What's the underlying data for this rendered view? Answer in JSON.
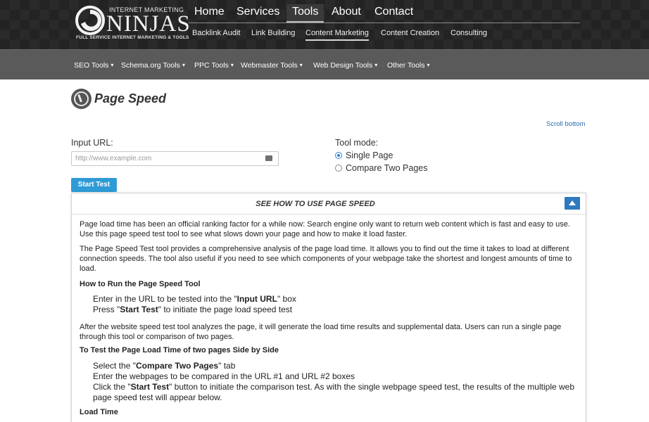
{
  "brand": {
    "top_text": "INTERNET MARKETING",
    "main_text": "NINJAS",
    "sub_text": "FULL SERVICE INTERNET MARKETING & TOOLS"
  },
  "main_nav": {
    "items": [
      {
        "label": "Home"
      },
      {
        "label": "Services"
      },
      {
        "label": "Tools"
      },
      {
        "label": "About"
      },
      {
        "label": "Contact"
      }
    ],
    "active": "Tools"
  },
  "sub_nav": {
    "items": [
      {
        "label": "Backlink Audit"
      },
      {
        "label": "Link Building"
      },
      {
        "label": "Content Marketing"
      },
      {
        "label": "Content Creation"
      },
      {
        "label": "Consulting"
      }
    ],
    "active": "Content Marketing"
  },
  "tools_bar": {
    "items": [
      {
        "label": "SEO Tools"
      },
      {
        "label": "Schema.org Tools"
      },
      {
        "label": "PPC Tools"
      },
      {
        "label": "Webmaster Tools"
      },
      {
        "label": "Web Design Tools"
      },
      {
        "label": "Other Tools"
      }
    ],
    "caret": "▾"
  },
  "page": {
    "title": "Page Speed",
    "scroll_link": "Scroll bottom"
  },
  "form": {
    "input_label": "Input URL:",
    "url_placeholder": "http://www.example.com",
    "url_value": "",
    "start_button": "Start Test",
    "mode_label": "Tool mode:",
    "modes": [
      {
        "label": "Single Page",
        "checked": true
      },
      {
        "label": "Compare Two Pages",
        "checked": false
      }
    ]
  },
  "panel": {
    "title": "SEE HOW TO USE PAGE SPEED",
    "p1": "Page load time has been an official ranking factor for a while now: Search engine only want to return web content which is fast and easy to use. Use this page speed test tool to see what slows down your page and how to make it load faster.",
    "p2": "The Page Speed Test tool provides a comprehensive analysis of the page load time. It allows you to find out the time it takes to load at different connection speeds. The tool also useful if you need to see which components of your webpage take the shortest and longest amounts of time to load.",
    "h1": "How to Run the Page Speed Tool",
    "steps1": [
      {
        "pre": "Enter in the URL to be tested into the \"",
        "bold": "Input URL",
        "post": "\" box"
      },
      {
        "pre": "Press \"",
        "bold": "Start Test",
        "post": "\" to initiate the page load speed test"
      }
    ],
    "p3": "After the website speed test tool analyzes the page, it will generate the load time results and supplemental data. Users can run a single page through this tool or comparison of two pages.",
    "h2": "To Test the Page Load Time of two pages Side by Side",
    "steps2": [
      {
        "pre": "Select the \"",
        "bold": "Compare Two Pages",
        "post": "\" tab"
      },
      {
        "pre": "Enter the webpages to be compared in the URL #1 and URL #2 boxes",
        "bold": "",
        "post": ""
      },
      {
        "pre": "Click the \"",
        "bold": "Start Test",
        "post": "\" button to initiate the comparison test. As with the single webpage speed test, the results of the multiple web page speed test will appear below."
      }
    ],
    "h3": "Load Time"
  },
  "colors": {
    "header_bg": "#232323",
    "tools_bar_bg": "#5a5a5a",
    "button_blue": "#2f9bd6",
    "collapse_blue": "#2f79be",
    "link_blue": "#2a6aa8"
  },
  "icons": {
    "logo": "ninja-swirl-logo-icon",
    "page": "speedometer-icon",
    "collapse": "triangle-up-icon",
    "caret": "caret-down-icon",
    "input_badge": "keyboard-icon"
  }
}
